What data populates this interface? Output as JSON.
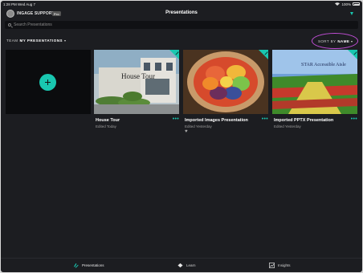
{
  "status": {
    "time": "1:28 PM",
    "date": "Wed Aug 7",
    "battery": "100%"
  },
  "header": {
    "org_name": "INGAGE SUPPORT",
    "pro_badge": "Pro",
    "title": "Presentations"
  },
  "search": {
    "placeholder": "Search Presentations",
    "value": ""
  },
  "filters": {
    "team_prefix": "TEAM",
    "team_value": "MY PRESENTATIONS",
    "sort_prefix": "SORT BY",
    "sort_value": "NAME"
  },
  "cards": [
    {
      "title": "House Tour",
      "subtitle": "Edited Today",
      "thumb_text": "House Tour",
      "favorited": false
    },
    {
      "title": "Imported Images Presentation",
      "subtitle": "Edited Yesterday",
      "favorited": true
    },
    {
      "title": "Imported PPTX Presentation",
      "subtitle": "Edited Yesterday",
      "thumb_text": "STAR Accessible Aisle",
      "favorited": false
    }
  ],
  "more_glyph": "•••",
  "heart_glyph": "♥",
  "tabs": [
    {
      "label": "Presentations",
      "icon": "presentations-icon",
      "active": true
    },
    {
      "label": "Learn",
      "icon": "learn-icon",
      "active": false
    },
    {
      "label": "Insights",
      "icon": "insights-icon",
      "active": false
    }
  ],
  "colors": {
    "accent": "#19c7b0",
    "highlight": "#c14ed6",
    "background": "#1c1d21"
  }
}
